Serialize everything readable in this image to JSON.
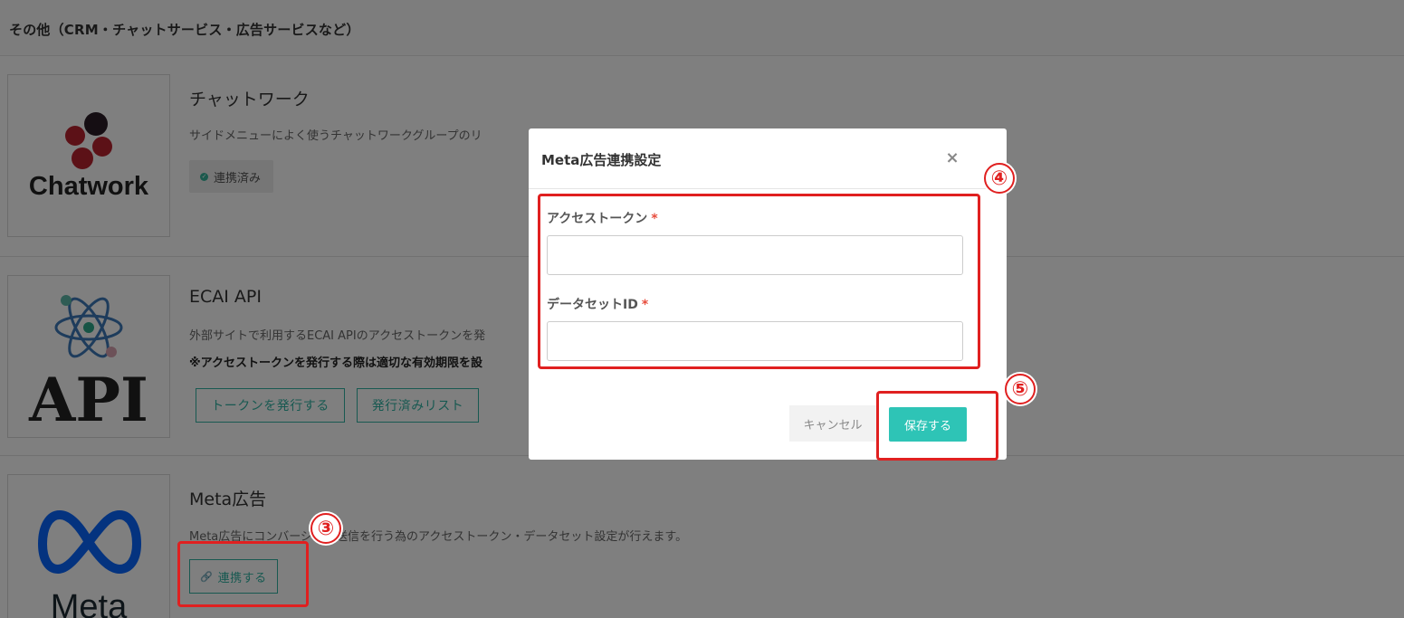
{
  "section": {
    "title": "その他（CRM・チャットサービス・広告サービスなど）"
  },
  "services": [
    {
      "title": "チャットワーク",
      "description": "サイドメニューによく使うチャットワークグループのリ",
      "status_label": "連携済み",
      "logo_text": "Chatwork",
      "colors": {
        "logo_red": "#b8232f",
        "logo_dark": "#2b1d26"
      }
    },
    {
      "title": "ECAI API",
      "description": "外部サイトで利用するECAI APIのアクセストークンを発",
      "note": "※アクセストークンを発行する際は適切な有効期限を設",
      "buttons": [
        "トークンを発行する",
        "発行済みリスト"
      ],
      "logo_text": "API"
    },
    {
      "title": "Meta広告",
      "description": "Meta広告にコンバージョン送信を行う為のアクセストークン・データセット設定が行えます。",
      "connect_label": "連携する",
      "logo_text": "Meta",
      "colors": {
        "logo_blue": "#0866ff"
      }
    }
  ],
  "modal": {
    "title": "Meta広告連携設定",
    "close_icon": "×",
    "fields": [
      {
        "label": "アクセストークン",
        "required_mark": "*",
        "value": ""
      },
      {
        "label": "データセットID",
        "required_mark": "*",
        "value": ""
      }
    ],
    "cancel_label": "キャンセル",
    "save_label": "保存する"
  },
  "annotations": {
    "step3": "③",
    "step4": "④",
    "step5": "⑤"
  },
  "colors": {
    "accent": "#2ec4b6",
    "outline": "#30b3a3",
    "callout": "#e02020",
    "required": "#e74c3c"
  }
}
